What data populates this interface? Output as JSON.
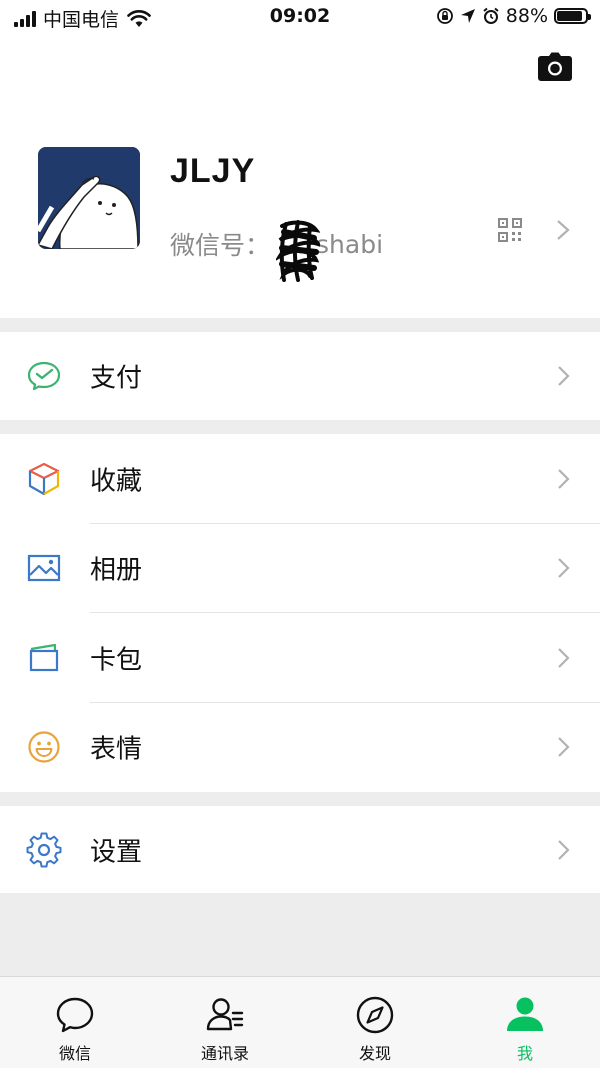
{
  "status_bar": {
    "carrier": "中国电信",
    "time": "09:02",
    "battery": "88%",
    "battery_level": 0.88
  },
  "profile": {
    "name": "JLJY",
    "id_prefix": "微信号：",
    "id_suffix": "shabi"
  },
  "menu": {
    "pay": "支付",
    "favorites": "收藏",
    "album": "相册",
    "cards": "卡包",
    "stickers": "表情",
    "settings": "设置"
  },
  "tabs": {
    "chats": "微信",
    "contacts": "通讯录",
    "discover": "发现",
    "me": "我",
    "active": "me"
  },
  "colors": {
    "accent_green": "#07c160",
    "pay_green": "#3cb371",
    "album_blue": "#3c78c8",
    "emoji_orange": "#e8a33d"
  }
}
